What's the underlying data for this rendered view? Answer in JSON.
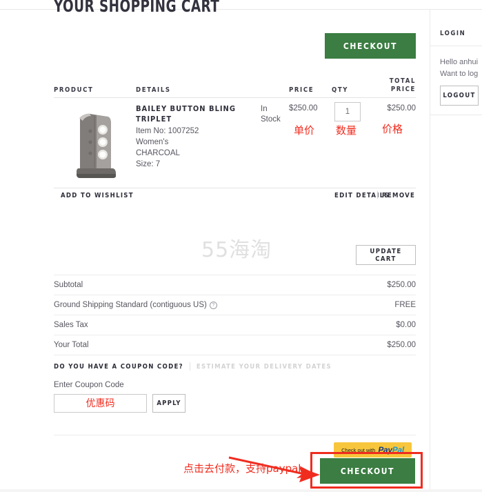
{
  "page": {
    "title": "YOUR SHOPPING CART",
    "watermark": "55海淘"
  },
  "checkout_top": {
    "label": "CHECKOUT"
  },
  "cart_table": {
    "headers": {
      "product": "PRODUCT",
      "details": "DETAILS",
      "price": "PRICE",
      "qty": "QTY",
      "total_line1": "TOTAL",
      "total_line2": "PRICE"
    },
    "items": [
      {
        "name": "BAILEY BUTTON BLING TRIPLET",
        "item_no": "Item No: 1007252",
        "gender": "Women's",
        "color": "CHARCOAL",
        "size": "Size: 7",
        "stock": "In Stock",
        "price": "$250.00",
        "qty": "1",
        "total": "$250.00",
        "thumb_alt": "grey-bling-boot"
      }
    ],
    "actions": {
      "wishlist": "ADD TO WISHLIST",
      "edit": "EDIT DETAILS",
      "remove": "REMOVE"
    }
  },
  "annotations": {
    "unit_price": "单价",
    "quantity": "数量",
    "price": "价格",
    "coupon_placeholder": "优惠码",
    "checkout_note": "点击去付款，支持paypal"
  },
  "update_cart": {
    "label": "UPDATE CART"
  },
  "summary": {
    "rows": [
      {
        "label": "Subtotal",
        "value": "$250.00",
        "info": false
      },
      {
        "label": "Ground Shipping Standard (contiguous US)",
        "value": "FREE",
        "info": true
      },
      {
        "label": "Sales Tax",
        "value": "$0.00",
        "info": false
      },
      {
        "label": "Your Total",
        "value": "$250.00",
        "info": false
      }
    ],
    "info_glyph": "?"
  },
  "coupon": {
    "tab_active": "DO YOU HAVE A COUPON CODE?",
    "tab_inactive": "ESTIMATE YOUR DELIVERY DATES",
    "field_label": "Enter Coupon Code",
    "apply_label": "APPLY"
  },
  "paypal": {
    "prefix": "Check out with",
    "logo_pay": "Pay",
    "logo_pal": "Pal"
  },
  "checkout_bottom": {
    "label": "CHECKOUT"
  },
  "sidebar": {
    "title": "LOGIN",
    "greeting_line1": "Hello anhui",
    "greeting_line2": "Want to log",
    "logout_label": "LOGOUT"
  },
  "colors": {
    "checkout_green": "#3b7d42",
    "annotation_red": "#f02c1f",
    "paypal_yellow": "#f8c63c"
  }
}
